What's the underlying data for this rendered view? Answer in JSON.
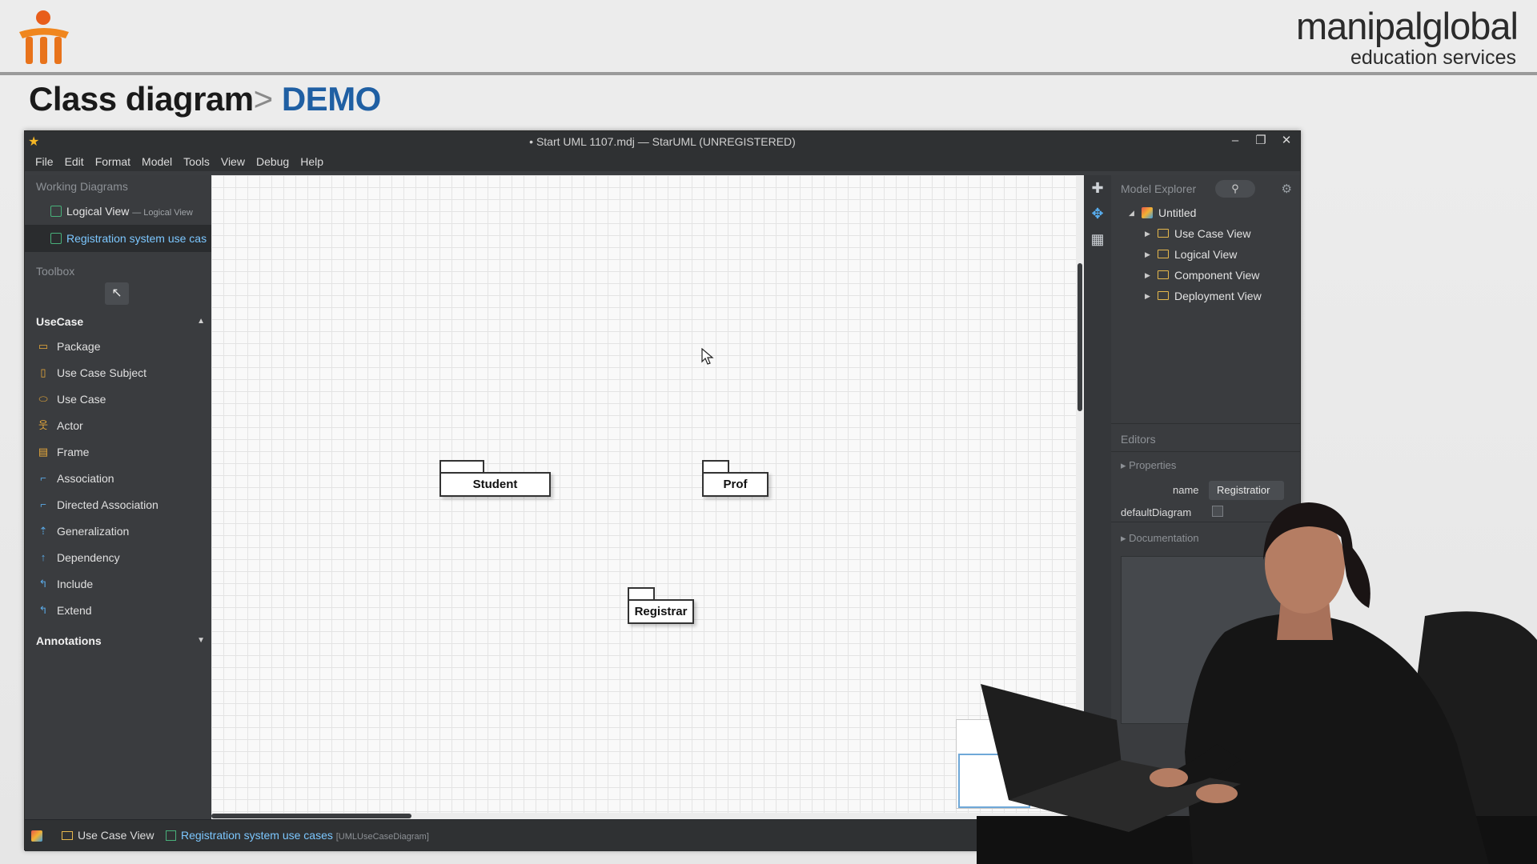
{
  "slide": {
    "brand_line1": "manipalglobal",
    "brand_line2": "education services",
    "title_main": "Class diagram",
    "title_sep": ">",
    "title_accent": "DEMO"
  },
  "window": {
    "title": "• Start UML 1107.mdj — StarUML (UNREGISTERED)",
    "controls": [
      "–",
      "❐",
      "✕"
    ]
  },
  "menu": [
    "File",
    "Edit",
    "Format",
    "Model",
    "Tools",
    "View",
    "Debug",
    "Help"
  ],
  "working_diagrams": {
    "label": "Working Diagrams",
    "items": [
      {
        "label": "Logical View",
        "sub": "— Logical View"
      },
      {
        "label": "Registration system use cas",
        "sub": ""
      }
    ]
  },
  "toolbox": {
    "label": "Toolbox",
    "pointer_icon": "↖",
    "group": "UseCase",
    "tools": [
      {
        "label": "Package",
        "icon": "folder-icon"
      },
      {
        "label": "Use Case Subject",
        "icon": "subject-icon"
      },
      {
        "label": "Use Case",
        "icon": "usecase-icon"
      },
      {
        "label": "Actor",
        "icon": "actor-icon"
      },
      {
        "label": "Frame",
        "icon": "frame-icon"
      },
      {
        "label": "Association",
        "icon": "association-icon"
      },
      {
        "label": "Directed Association",
        "icon": "directed-association-icon"
      },
      {
        "label": "Generalization",
        "icon": "generalization-icon"
      },
      {
        "label": "Dependency",
        "icon": "dependency-icon"
      },
      {
        "label": "Include",
        "icon": "include-icon"
      },
      {
        "label": "Extend",
        "icon": "extend-icon"
      }
    ],
    "annotations": "Annotations"
  },
  "canvas": {
    "packages": [
      "Student",
      "Prof",
      "Registrar"
    ]
  },
  "explorer": {
    "label": "Model Explorer",
    "root": "Untitled",
    "children": [
      "Use Case View",
      "Logical View",
      "Component View",
      "Deployment View"
    ]
  },
  "editors": {
    "label": "Editors",
    "properties": "Properties",
    "name_label": "name",
    "name_value": "Registratior",
    "default_diagram_label": "defaultDiagram",
    "documentation": "Documentation"
  },
  "statusbar": {
    "view": "Use Case View",
    "diagram": "Registration system use cases",
    "diagram_type": "[UMLUseCaseDiagram]"
  },
  "colors": {
    "accent_title": "#1f5fa3",
    "app_bg": "#3a3c3f",
    "highlight": "#7cc7ff"
  }
}
